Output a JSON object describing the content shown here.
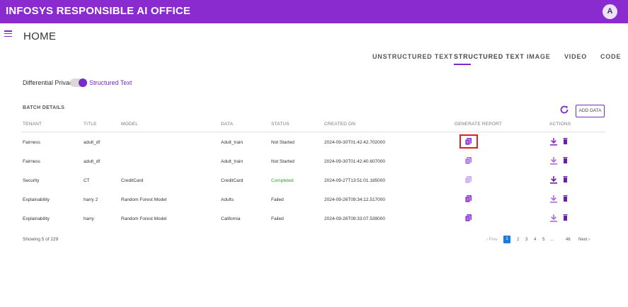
{
  "app": {
    "brand": "INFOSYS RESPONSIBLE AI OFFICE",
    "avatar": "A"
  },
  "page": {
    "title": "HOME"
  },
  "tabs": [
    {
      "label": "UNSTRUCTURED TEXT",
      "active": false
    },
    {
      "label": "STRUCTURED TEXT",
      "active": true
    },
    {
      "label": "IMAGE",
      "active": false
    },
    {
      "label": "VIDEO",
      "active": false
    },
    {
      "label": "CODE",
      "active": false
    }
  ],
  "privacy": {
    "label": "Differential Privacy",
    "value": "Structured Text",
    "enabled": true
  },
  "batch": {
    "title": "BATCH DETAILS",
    "add_button": "ADD DATA",
    "columns": [
      "TENANT",
      "TITLE",
      "MODEL",
      "DATA",
      "STATUS",
      "CREATED ON",
      "GENERATE REPORT",
      "ACTIONS"
    ],
    "rows": [
      {
        "tenant": "Fairness",
        "title": "adult_df",
        "model": "",
        "data": "Adult_train",
        "status": "Not Started",
        "created": "2024-09-30T01:42:42.702000"
      },
      {
        "tenant": "Fairness",
        "title": "adult_df",
        "model": "",
        "data": "Adult_train",
        "status": "Not Started",
        "created": "2024-09-30T01:42:40.607000"
      },
      {
        "tenant": "Security",
        "title": "CT",
        "model": "CreditCard",
        "data": "CreditCard",
        "status": "Completed",
        "created": "2024-09-27T13:51:01.185000"
      },
      {
        "tenant": "Explainability",
        "title": "harry 2",
        "model": "Random Forest Model",
        "data": "Adults",
        "status": "Failed",
        "created": "2024-09-26T09:34:12.517000"
      },
      {
        "tenant": "Explainability",
        "title": "harry",
        "model": "Random Forest Model",
        "data": "California",
        "status": "Failed",
        "created": "2024-09-26T09:33:07.539000"
      }
    ],
    "showing": "Showing 5 of 229"
  },
  "pagination": {
    "prev": "‹ Prev",
    "pages": [
      "1",
      "2",
      "3",
      "4",
      "5",
      "...",
      "46"
    ],
    "next": "Next ›",
    "current": "1"
  },
  "colors": {
    "brand": "#8a2bcf",
    "accent": "#7a2bc7",
    "highlight": "#e21f1f",
    "page_active": "#1a7ce0",
    "success": "#2e9b2e"
  },
  "icons": {
    "menu": "hamburger-icon",
    "refresh": "refresh-icon",
    "report": "report-icon",
    "download": "download-icon",
    "delete": "trash-icon"
  }
}
